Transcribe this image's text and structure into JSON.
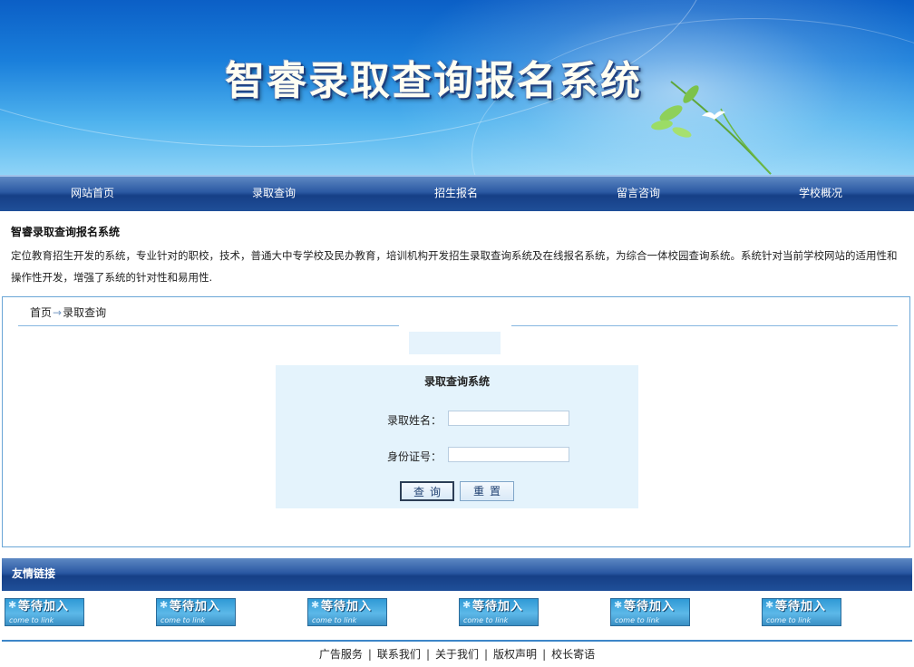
{
  "header": {
    "title": "智睿录取查询报名系统"
  },
  "nav": {
    "items": [
      "网站首页",
      "录取查询",
      "招生报名",
      "留言咨询",
      "学校概况"
    ]
  },
  "intro": {
    "title": "智睿录取查询报名系统",
    "text": "定位教育招生开发的系统，专业针对的职校，技术，普通大中专学校及民办教育，培训机构开发招生录取查询系统及在线报名系统，为综合一体校园查询系统。系统针对当前学校网站的适用性和操作性开发，增强了系统的针对性和易用性."
  },
  "breadcrumb": {
    "home": "首页",
    "arrow": "→",
    "current": "录取查询"
  },
  "form": {
    "title": "录取查询系统",
    "name_label": "录取姓名：",
    "name_value": "",
    "id_label": "身份证号：",
    "id_value": "",
    "query_button": "查询",
    "reset_button": "重置"
  },
  "links": {
    "title": "友情链接",
    "badges": [
      {
        "main": "等待加入",
        "sub": "come to link"
      },
      {
        "main": "等待加入",
        "sub": "come to link"
      },
      {
        "main": "等待加入",
        "sub": "come to link"
      },
      {
        "main": "等待加入",
        "sub": "come to link"
      },
      {
        "main": "等待加入",
        "sub": "come to link"
      },
      {
        "main": "等待加入",
        "sub": "come to link"
      }
    ]
  },
  "footer": {
    "items": [
      "广告服务",
      "联系我们",
      "关于我们",
      "版权声明",
      "校长寄语"
    ],
    "separator": "|"
  },
  "colors": {
    "nav_dark": "#163f86",
    "banner_blue": "#1a7fdb",
    "form_bg": "#e4f3fc",
    "border_blue": "#6aa6d6"
  }
}
